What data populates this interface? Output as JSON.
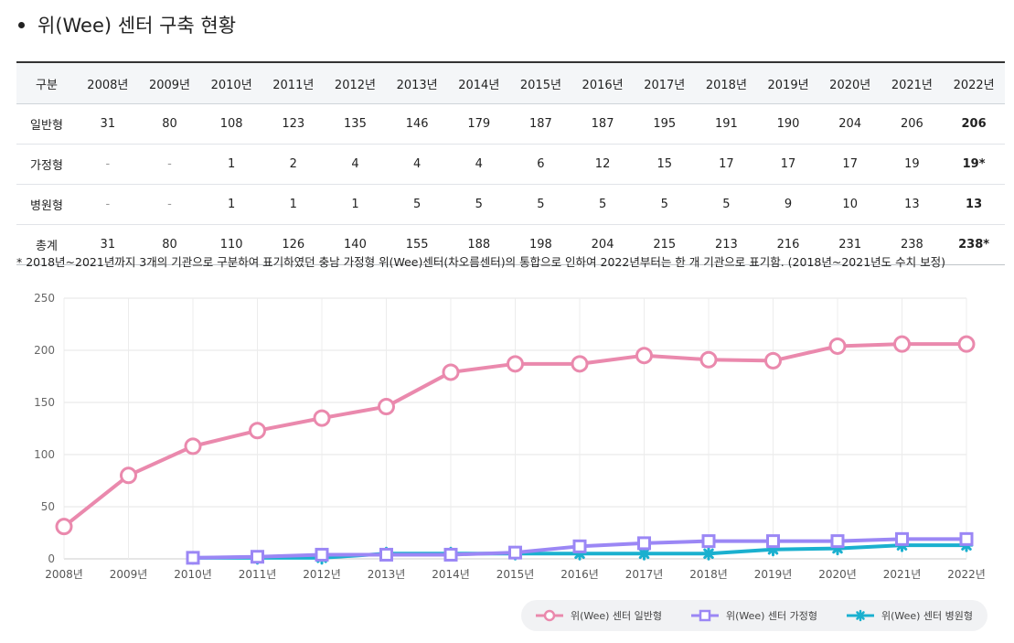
{
  "title": "위(Wee) 센터 구축 현황",
  "table": {
    "header": [
      "구분",
      "2008년",
      "2009년",
      "2010년",
      "2011년",
      "2012년",
      "2013년",
      "2014년",
      "2015년",
      "2016년",
      "2017년",
      "2018년",
      "2019년",
      "2020년",
      "2021년",
      "2022년"
    ],
    "rows": [
      {
        "label": "일반형",
        "cells": [
          "31",
          "80",
          "108",
          "123",
          "135",
          "146",
          "179",
          "187",
          "187",
          "195",
          "191",
          "190",
          "204",
          "206",
          "206"
        ]
      },
      {
        "label": "가정형",
        "cells": [
          "-",
          "-",
          "1",
          "2",
          "4",
          "4",
          "4",
          "6",
          "12",
          "15",
          "17",
          "17",
          "17",
          "19",
          "19*"
        ]
      },
      {
        "label": "병원형",
        "cells": [
          "-",
          "-",
          "1",
          "1",
          "1",
          "5",
          "5",
          "5",
          "5",
          "5",
          "5",
          "9",
          "10",
          "13",
          "13"
        ]
      },
      {
        "label": "총계",
        "cells": [
          "31",
          "80",
          "110",
          "126",
          "140",
          "155",
          "188",
          "198",
          "204",
          "215",
          "213",
          "216",
          "231",
          "238",
          "238*"
        ]
      }
    ]
  },
  "note": "* 2018년~2021년까지 3개의 기관으로 구분하여 표기하였던 충남 가정형 위(Wee)센터(차오름센터)의 통합으로 인하여 2022년부터는 한 개 기관으로 표기함. (2018년~2021년도 수치 보정)",
  "chart_data": {
    "type": "line",
    "categories": [
      "2008년",
      "2009년",
      "2010년",
      "2011년",
      "2012년",
      "2013년",
      "2014년",
      "2015년",
      "2016년",
      "2017년",
      "2018년",
      "2019년",
      "2020년",
      "2021년",
      "2022년"
    ],
    "yticks": [
      "0",
      "50",
      "100",
      "150",
      "200",
      "250"
    ],
    "ylim": [
      0,
      250
    ],
    "grid": true,
    "legend_position": "bottom-right",
    "series": [
      {
        "name": "위(Wee) 센터 일반형",
        "color": "#ea89ad",
        "marker": "circle",
        "values": [
          31,
          80,
          108,
          123,
          135,
          146,
          179,
          187,
          187,
          195,
          191,
          190,
          204,
          206,
          206
        ]
      },
      {
        "name": "위(Wee) 센터 가정형",
        "color": "#9b87f5",
        "marker": "square",
        "values": [
          null,
          null,
          1,
          2,
          4,
          4,
          4,
          6,
          12,
          15,
          17,
          17,
          17,
          19,
          19
        ]
      },
      {
        "name": "위(Wee) 센터 병원형",
        "color": "#1ab0cf",
        "marker": "star",
        "values": [
          null,
          null,
          1,
          1,
          1,
          5,
          5,
          5,
          5,
          5,
          5,
          9,
          10,
          13,
          13
        ]
      }
    ]
  }
}
